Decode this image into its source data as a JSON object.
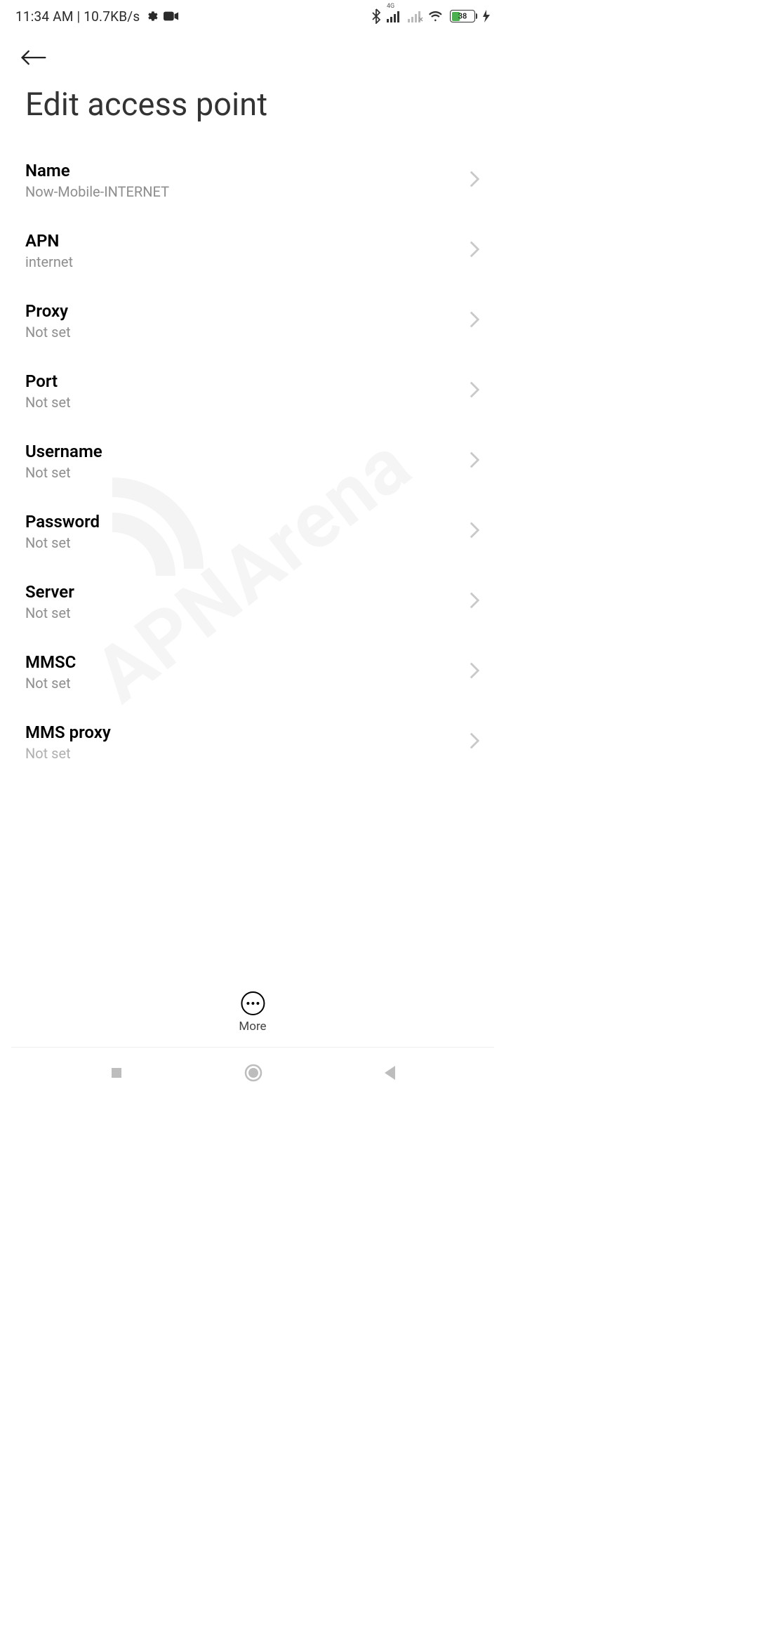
{
  "status_bar": {
    "time": "11:34 AM",
    "separator": " | ",
    "net_speed": "10.7KB/s",
    "signal_label": "4G",
    "battery_percent": "38"
  },
  "page": {
    "title": "Edit access point"
  },
  "settings": [
    {
      "key": "name",
      "label": "Name",
      "value": "Now-Mobile-INTERNET"
    },
    {
      "key": "apn",
      "label": "APN",
      "value": "internet"
    },
    {
      "key": "proxy",
      "label": "Proxy",
      "value": "Not set"
    },
    {
      "key": "port",
      "label": "Port",
      "value": "Not set"
    },
    {
      "key": "username",
      "label": "Username",
      "value": "Not set"
    },
    {
      "key": "password",
      "label": "Password",
      "value": "Not set"
    },
    {
      "key": "server",
      "label": "Server",
      "value": "Not set"
    },
    {
      "key": "mmsc",
      "label": "MMSC",
      "value": "Not set"
    },
    {
      "key": "mms-proxy",
      "label": "MMS proxy",
      "value": "Not set"
    }
  ],
  "actions": {
    "more": "More"
  },
  "watermark": "APNArena"
}
